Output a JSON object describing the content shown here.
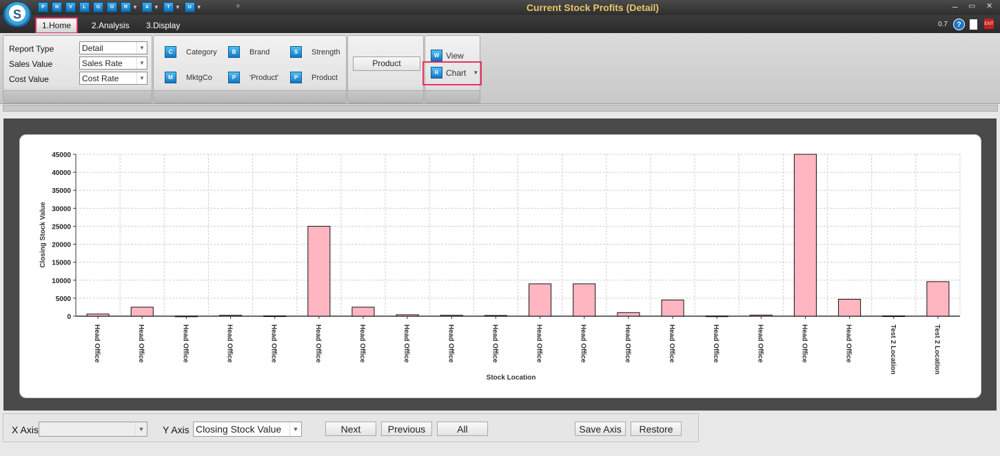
{
  "app": {
    "title": "Current Stock Profits (Detail)",
    "logo_text": "S"
  },
  "quick_access": [
    {
      "text": "P",
      "icon": "quick-access-p-icon",
      "dropdown": false
    },
    {
      "text": "N",
      "icon": "quick-access-n-icon",
      "dropdown": false
    },
    {
      "text": "V",
      "icon": "quick-access-v-icon",
      "dropdown": false
    },
    {
      "text": "L",
      "icon": "quick-access-l-icon",
      "dropdown": false
    },
    {
      "text": "G",
      "icon": "quick-access-g-icon",
      "dropdown": false
    },
    {
      "text": "O",
      "icon": "quick-access-o-icon",
      "dropdown": false
    },
    {
      "text": "R",
      "icon": "quick-access-r-icon",
      "dropdown": true
    },
    {
      "text": "A",
      "icon": "quick-access-a-icon",
      "dropdown": true
    },
    {
      "text": "T",
      "icon": "quick-access-t-icon",
      "dropdown": true
    },
    {
      "text": "U",
      "icon": "quick-access-u-icon",
      "dropdown": true
    }
  ],
  "window_controls": {
    "minimize": "‒",
    "restore": "▭",
    "close": "✕",
    "customize": "≑"
  },
  "tabs": [
    {
      "label": "1.Home",
      "active": true
    },
    {
      "label": "2.Analysis",
      "active": false
    },
    {
      "label": "3.Display",
      "active": false
    }
  ],
  "version": "0.7",
  "help_glyph": "?",
  "exit_text": "EXIT",
  "report_settings": {
    "report_type": {
      "label": "Report Type",
      "value": "Detail"
    },
    "sales_value": {
      "label": "Sales Value",
      "value": "Sales Rate"
    },
    "cost_value": {
      "label": "Cost Value",
      "value": "Cost Rate"
    }
  },
  "group_buttons": [
    {
      "label": "Category",
      "icon": "category-icon",
      "glyph": "C"
    },
    {
      "label": "Brand",
      "icon": "brand-icon",
      "glyph": "B"
    },
    {
      "label": "Strength",
      "icon": "strength-icon",
      "glyph": "S"
    },
    {
      "label": "MktgCo",
      "icon": "mktgco-icon",
      "glyph": "M"
    },
    {
      "label": "'Product'",
      "icon": "product-quoted-icon",
      "glyph": "P"
    },
    {
      "label": "Product",
      "icon": "product-icon",
      "glyph": "P"
    }
  ],
  "product_button": "Product",
  "view_buttons": {
    "view": {
      "label": "View",
      "glyph": "W"
    },
    "chart": {
      "label": "Chart",
      "glyph": "R"
    }
  },
  "chart_data": {
    "type": "bar",
    "xlabel": "Stock Location",
    "ylabel": "Closing Stock Value",
    "ylim": [
      0,
      45000
    ],
    "yticks": [
      0,
      5000,
      10000,
      15000,
      20000,
      25000,
      30000,
      35000,
      40000,
      45000
    ],
    "grid": true,
    "bar_color": "#ffb6c1",
    "categories": [
      "Head Office",
      "Head Office",
      "Head Office",
      "Head Office",
      "Head Office",
      "Head Office",
      "Head Office",
      "Head Office",
      "Head Office",
      "Head Office",
      "Head Office",
      "Head Office",
      "Head Office",
      "Head Office",
      "Head Office",
      "Head Office",
      "Head Office",
      "Head Office",
      "Test 2 Location",
      "Test 2 Location"
    ],
    "values": [
      600,
      2500,
      30,
      250,
      80,
      25000,
      2500,
      400,
      250,
      200,
      9000,
      9000,
      1000,
      4500,
      50,
      300,
      45000,
      4700,
      80,
      9600
    ]
  },
  "bottom_controls": {
    "x_axis_label": "X Axis",
    "x_axis_value": "",
    "y_axis_label": "Y Axis",
    "y_axis_value": "Closing Stock Value",
    "next": "Next",
    "previous": "Previous",
    "all": "All",
    "save_axis": "Save Axis",
    "restore": "Restore"
  }
}
